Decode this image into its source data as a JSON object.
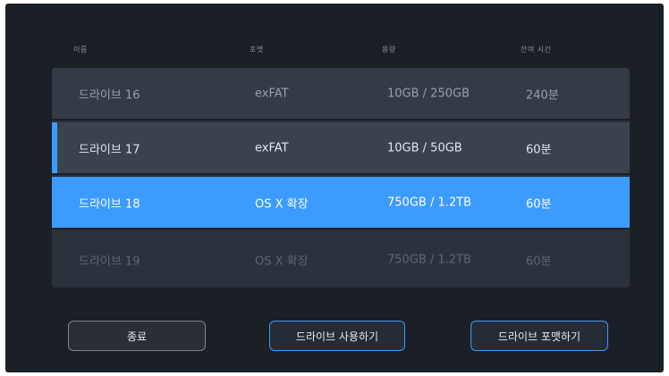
{
  "header": {
    "name": "이름",
    "format": "포맷",
    "capacity": "용량",
    "recording_time": "잔여 시간"
  },
  "drives": [
    {
      "name": "드라이브 16",
      "format": "exFAT",
      "capacity": "10GB / 250GB",
      "time": "240분",
      "state": "dimmed"
    },
    {
      "name": "드라이브 17",
      "format": "exFAT",
      "capacity": "10GB / 50GB",
      "time": "60분",
      "state": "active"
    },
    {
      "name": "드라이브 18",
      "format": "OS X 확장",
      "capacity": "750GB / 1.2TB",
      "time": "60분",
      "state": "selected"
    },
    {
      "name": "드라이브 19",
      "format": "OS X 확장",
      "capacity": "750GB / 1.2TB",
      "time": "60분",
      "state": "faded"
    }
  ],
  "buttons": {
    "exit": "종료",
    "use_drive": "드라이브 사용하기",
    "format_drive": "드라이브 포맷하기"
  },
  "colors": {
    "background": "#1b1f26",
    "accent": "#3c9bff",
    "list": "#2b323c"
  }
}
